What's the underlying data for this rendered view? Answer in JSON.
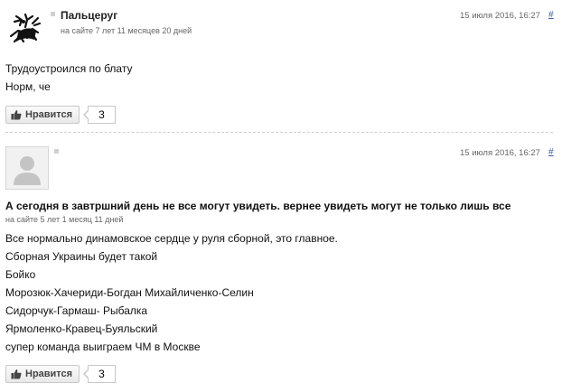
{
  "comments": [
    {
      "username": "Пальцеруг",
      "membership": "на сайте 7 лет 11 месяцев 20 дней",
      "timestamp": "15 июля 2016, 16:27",
      "permalink": "#",
      "avatar_icon": "doodle-figure-avatar",
      "body_lines": [
        "Трудоустроился по блату",
        "Норм, че"
      ],
      "like_label": "Нравится",
      "like_count": "3"
    },
    {
      "username": "",
      "title": "А сегодня в завтршний день не все могут увидеть. вернее увидеть могут не только лишь все",
      "membership": "на сайте 5 лет 1 месяц 11 дней",
      "timestamp": "15 июля 2016, 16:27",
      "permalink": "#",
      "avatar_icon": "default-user-avatar",
      "body_lines": [
        "Все нормально динамовское сердце у руля сборной, это главное.",
        "Сборная Украины будет такой",
        "Бойко",
        "Морозюк-Хачериди-Богдан Михайличенко-Селин",
        "Сидорчук-Гармаш- Рыбалка",
        "Ярмоленко-Кравец-Буяльский",
        "супер команда выиграем ЧМ в Москве"
      ],
      "like_label": "Нравится",
      "like_count": "3"
    }
  ],
  "colors": {
    "link": "#3a5c9c",
    "meta": "#666666",
    "border": "#c8c8c8"
  }
}
